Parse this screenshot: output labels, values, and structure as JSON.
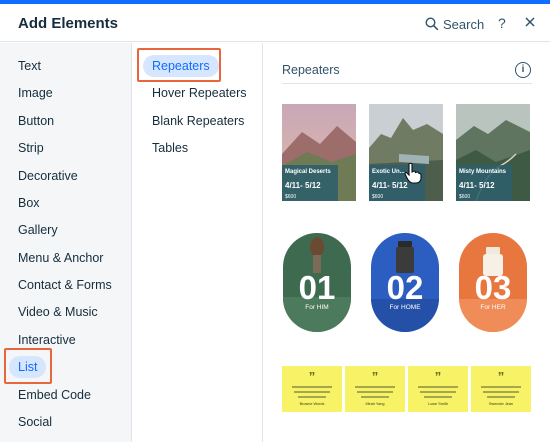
{
  "header": {
    "title": "Add Elements",
    "search_label": "Search",
    "help_label": "?"
  },
  "categories": [
    {
      "label": "Text"
    },
    {
      "label": "Image"
    },
    {
      "label": "Button"
    },
    {
      "label": "Strip"
    },
    {
      "label": "Decorative"
    },
    {
      "label": "Box"
    },
    {
      "label": "Gallery"
    },
    {
      "label": "Menu & Anchor"
    },
    {
      "label": "Contact & Forms"
    },
    {
      "label": "Video & Music"
    },
    {
      "label": "Interactive"
    },
    {
      "label": "List",
      "selected": true
    },
    {
      "label": "Embed Code"
    },
    {
      "label": "Social"
    }
  ],
  "subcategories": [
    {
      "label": "Repeaters",
      "selected": true
    },
    {
      "label": "Hover Repeaters"
    },
    {
      "label": "Blank Repeaters"
    },
    {
      "label": "Tables"
    }
  ],
  "panel": {
    "title": "Repeaters",
    "info_label": "i"
  },
  "repeater_cards": [
    {
      "name": "Magical Deserts",
      "dates": "4/11- 5/12",
      "price": "$600"
    },
    {
      "name": "Exotic Un...",
      "dates": "4/11- 5/12",
      "price": "$600"
    },
    {
      "name": "Misty Mountains",
      "dates": "4/11- 5/12",
      "price": "$600"
    }
  ],
  "product_pills": [
    {
      "number": "01",
      "label": "For HIM",
      "color": "#3e6b4f"
    },
    {
      "number": "02",
      "label": "For HOME",
      "color": "#2c5ec2"
    },
    {
      "number": "03",
      "label": "For HER",
      "color": "#e8763f"
    }
  ],
  "testimonials": [
    {
      "name": "Browne Words"
    },
    {
      "name": "Mirah Yang"
    },
    {
      "name": "Lowe Smith"
    },
    {
      "name": "Swender Jean"
    }
  ],
  "colors": {
    "accent": "#116dff",
    "highlight_box": "#e8663c",
    "selected_bg": "#d6e6fe",
    "quote_bg": "#f8f267"
  }
}
